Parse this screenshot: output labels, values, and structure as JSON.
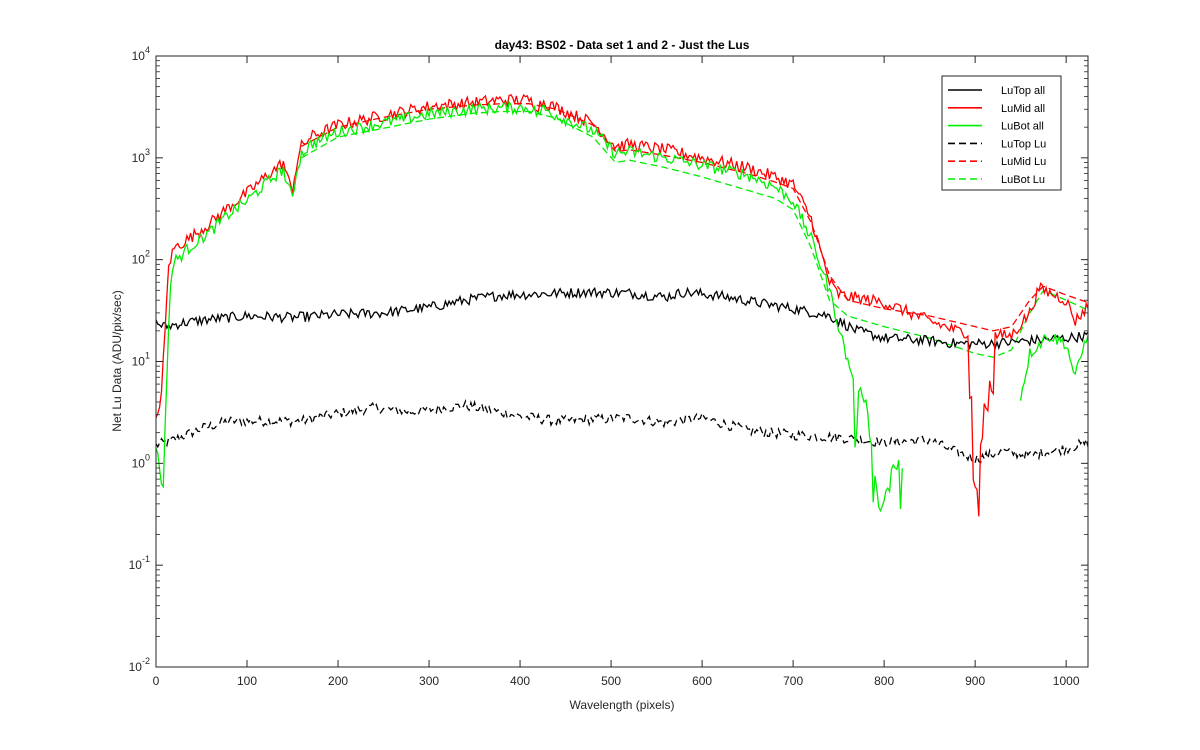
{
  "chart_data": {
    "type": "line",
    "title": "day43: BS02 - Data set 1 and 2 - Just the Lus",
    "xlabel": "Wavelength (pixels)",
    "ylabel": "Net Lu Data (ADU/pix/sec)",
    "xlim": [
      0,
      1024
    ],
    "ylim": [
      0.01,
      10000
    ],
    "yscale": "log",
    "grid": false,
    "legend_position": "top-right",
    "x_ticks": [
      "0",
      "100",
      "200",
      "300",
      "400",
      "500",
      "600",
      "700",
      "800",
      "900",
      "1000"
    ],
    "y_ticks": [
      {
        "base": "10",
        "exp": "-2"
      },
      {
        "base": "10",
        "exp": "-1"
      },
      {
        "base": "10",
        "exp": "0"
      },
      {
        "base": "10",
        "exp": "1"
      },
      {
        "base": "10",
        "exp": "2"
      },
      {
        "base": "10",
        "exp": "3"
      },
      {
        "base": "10",
        "exp": "4"
      }
    ],
    "series": [
      {
        "name": "LuTop  all",
        "color": "#000000",
        "dash": "solid",
        "noise": 0.05,
        "points": [
          [
            0,
            24
          ],
          [
            10,
            22
          ],
          [
            30,
            24
          ],
          [
            60,
            26
          ],
          [
            100,
            28
          ],
          [
            150,
            27
          ],
          [
            200,
            29
          ],
          [
            250,
            30
          ],
          [
            300,
            34
          ],
          [
            340,
            40
          ],
          [
            380,
            45
          ],
          [
            420,
            46
          ],
          [
            470,
            48
          ],
          [
            520,
            47
          ],
          [
            560,
            43
          ],
          [
            580,
            48
          ],
          [
            620,
            44
          ],
          [
            660,
            38
          ],
          [
            700,
            33
          ],
          [
            740,
            28
          ],
          [
            770,
            20
          ],
          [
            800,
            17
          ],
          [
            850,
            16
          ],
          [
            880,
            15
          ],
          [
            920,
            15
          ],
          [
            960,
            16
          ],
          [
            1000,
            17
          ],
          [
            1024,
            18
          ]
        ]
      },
      {
        "name": "LuMid  all",
        "color": "#ff0000",
        "dash": "solid",
        "noise": 0.06,
        "points": [
          [
            0,
            2.5
          ],
          [
            6,
            5
          ],
          [
            10,
            20
          ],
          [
            14,
            90
          ],
          [
            20,
            130
          ],
          [
            40,
            170
          ],
          [
            60,
            230
          ],
          [
            80,
            330
          ],
          [
            100,
            450
          ],
          [
            120,
            650
          ],
          [
            140,
            900
          ],
          [
            145,
            600
          ],
          [
            150,
            500
          ],
          [
            155,
            900
          ],
          [
            160,
            1300
          ],
          [
            170,
            1600
          ],
          [
            200,
            2100
          ],
          [
            250,
            2600
          ],
          [
            300,
            3200
          ],
          [
            350,
            3500
          ],
          [
            380,
            3700
          ],
          [
            410,
            3700
          ],
          [
            420,
            3200
          ],
          [
            425,
            3600
          ],
          [
            440,
            3100
          ],
          [
            480,
            2200
          ],
          [
            505,
            1300
          ],
          [
            520,
            1350
          ],
          [
            560,
            1200
          ],
          [
            600,
            1000
          ],
          [
            650,
            800
          ],
          [
            680,
            650
          ],
          [
            700,
            550
          ],
          [
            720,
            250
          ],
          [
            740,
            60
          ],
          [
            750,
            45
          ],
          [
            800,
            38
          ],
          [
            850,
            25
          ],
          [
            880,
            20
          ],
          [
            920,
            18
          ],
          [
            940,
            18
          ],
          [
            960,
            30
          ],
          [
            970,
            52
          ],
          [
            980,
            48
          ],
          [
            1000,
            40
          ],
          [
            1010,
            25
          ],
          [
            1024,
            35
          ]
        ],
        "dips": [
          [
            895,
            5
          ],
          [
            900,
            0.6
          ],
          [
            903,
            0.35
          ],
          [
            906,
            1.5
          ],
          [
            912,
            3
          ],
          [
            918,
            6
          ]
        ]
      },
      {
        "name": "LuBot  all",
        "color": "#00ee00",
        "dash": "solid",
        "noise": 0.06,
        "points": [
          [
            0,
            1.5
          ],
          [
            8,
            0.55
          ],
          [
            12,
            8
          ],
          [
            16,
            60
          ],
          [
            20,
            95
          ],
          [
            40,
            140
          ],
          [
            60,
            190
          ],
          [
            80,
            280
          ],
          [
            100,
            380
          ],
          [
            120,
            550
          ],
          [
            140,
            780
          ],
          [
            145,
            500
          ],
          [
            150,
            420
          ],
          [
            155,
            780
          ],
          [
            160,
            1100
          ],
          [
            170,
            1350
          ],
          [
            200,
            1800
          ],
          [
            250,
            2200
          ],
          [
            300,
            2700
          ],
          [
            350,
            3000
          ],
          [
            380,
            3100
          ],
          [
            410,
            3100
          ],
          [
            420,
            2700
          ],
          [
            425,
            3050
          ],
          [
            440,
            2600
          ],
          [
            480,
            1850
          ],
          [
            505,
            1100
          ],
          [
            520,
            1150
          ],
          [
            560,
            1000
          ],
          [
            600,
            850
          ],
          [
            650,
            680
          ],
          [
            680,
            520
          ],
          [
            700,
            380
          ],
          [
            720,
            160
          ],
          [
            740,
            50
          ],
          [
            760,
            10
          ],
          [
            780,
            4
          ],
          [
            795,
            0.3
          ],
          [
            810,
            1
          ],
          [
            820,
            1
          ]
        ],
        "tail": [
          [
            950,
            4.5
          ],
          [
            960,
            12
          ],
          [
            980,
            18
          ],
          [
            1000,
            15
          ],
          [
            1010,
            7
          ],
          [
            1024,
            20
          ]
        ]
      },
      {
        "name": "LuTop  Lu",
        "color": "#000000",
        "dash": "dashed",
        "noise": 0.05,
        "points": [
          [
            0,
            1.5
          ],
          [
            20,
            1.7
          ],
          [
            50,
            2.2
          ],
          [
            80,
            2.6
          ],
          [
            120,
            2.6
          ],
          [
            160,
            2.6
          ],
          [
            200,
            3.1
          ],
          [
            240,
            3.5
          ],
          [
            280,
            3.2
          ],
          [
            340,
            3.7
          ],
          [
            400,
            2.9
          ],
          [
            440,
            2.6
          ],
          [
            480,
            2.7
          ],
          [
            520,
            2.8
          ],
          [
            560,
            2.5
          ],
          [
            600,
            2.8
          ],
          [
            650,
            2.1
          ],
          [
            700,
            1.9
          ],
          [
            750,
            1.8
          ],
          [
            800,
            1.6
          ],
          [
            850,
            1.7
          ],
          [
            870,
            1.4
          ],
          [
            900,
            1.1
          ],
          [
            930,
            1.3
          ],
          [
            960,
            1.2
          ],
          [
            1000,
            1.4
          ],
          [
            1024,
            1.6
          ]
        ]
      },
      {
        "name": "LuMid  Lu",
        "color": "#ff0000",
        "dash": "dashed",
        "noise": 0.0,
        "points": [
          [
            160,
            1300
          ],
          [
            200,
            2000
          ],
          [
            250,
            2500
          ],
          [
            300,
            3000
          ],
          [
            350,
            3300
          ],
          [
            380,
            3400
          ],
          [
            410,
            3400
          ],
          [
            440,
            3000
          ],
          [
            480,
            2100
          ],
          [
            505,
            1150
          ],
          [
            520,
            1200
          ],
          [
            560,
            1050
          ],
          [
            600,
            900
          ],
          [
            650,
            700
          ],
          [
            680,
            580
          ],
          [
            700,
            500
          ],
          [
            720,
            230
          ],
          [
            740,
            70
          ],
          [
            760,
            40
          ],
          [
            800,
            33
          ],
          [
            850,
            28
          ],
          [
            900,
            22
          ],
          [
            920,
            20
          ],
          [
            940,
            22
          ],
          [
            960,
            40
          ],
          [
            975,
            55
          ],
          [
            1000,
            45
          ],
          [
            1024,
            38
          ]
        ]
      },
      {
        "name": "LuBot  Lu",
        "color": "#00ee00",
        "dash": "dashed",
        "noise": 0.0,
        "points": [
          [
            160,
            1000
          ],
          [
            200,
            1600
          ],
          [
            250,
            1950
          ],
          [
            300,
            2400
          ],
          [
            350,
            2750
          ],
          [
            380,
            2850
          ],
          [
            410,
            2850
          ],
          [
            440,
            2450
          ],
          [
            480,
            1600
          ],
          [
            505,
            900
          ],
          [
            520,
            950
          ],
          [
            560,
            800
          ],
          [
            600,
            650
          ],
          [
            650,
            480
          ],
          [
            680,
            400
          ],
          [
            700,
            310
          ],
          [
            720,
            130
          ],
          [
            740,
            40
          ],
          [
            760,
            28
          ],
          [
            800,
            22
          ],
          [
            850,
            17
          ],
          [
            900,
            12
          ],
          [
            920,
            11
          ],
          [
            940,
            13
          ],
          [
            960,
            30
          ],
          [
            975,
            50
          ],
          [
            1000,
            40
          ],
          [
            1024,
            32
          ]
        ]
      }
    ]
  }
}
